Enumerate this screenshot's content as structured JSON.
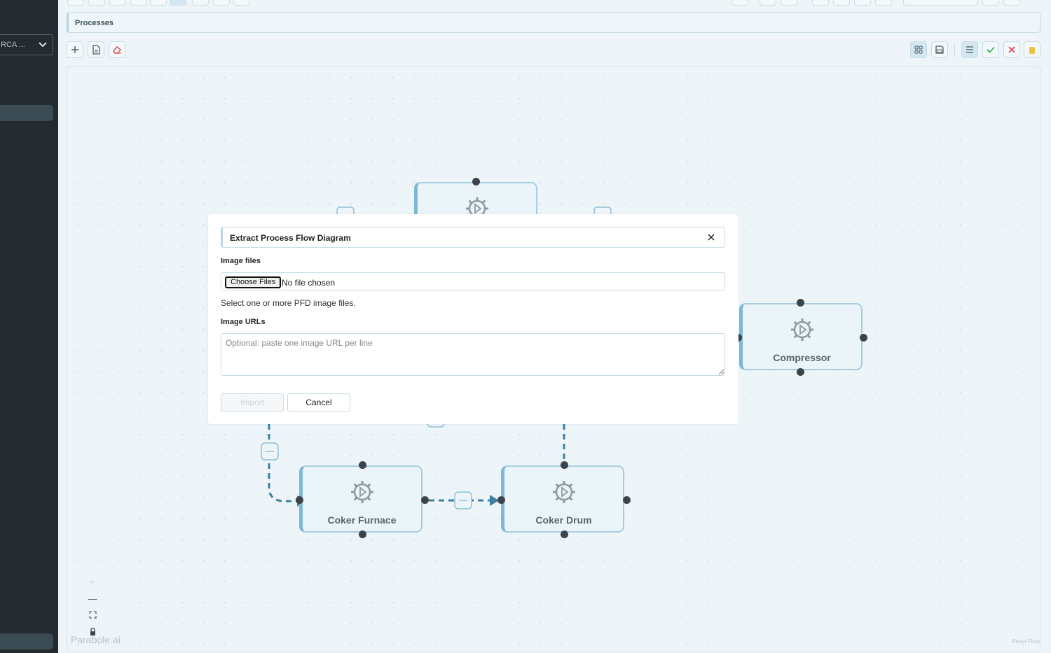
{
  "sidebar": {
    "dropdown_value": "RCA ..."
  },
  "header": {
    "title": "Processes"
  },
  "nodes": [
    {
      "label": ""
    },
    {
      "label": "Compressor"
    },
    {
      "label": "Coker Furnace"
    },
    {
      "label": "Coker Drum"
    }
  ],
  "canvas": {
    "watermark": "Parabole.ai",
    "attribution": "React Flow"
  },
  "dialog": {
    "title": "Extract Process Flow Diagram",
    "image_files_label": "Image files",
    "choose_button": "Choose Files",
    "file_status": "No file chosen",
    "hint": "Select one or more PFD image files.",
    "image_urls_label": "Image URLs",
    "urls_placeholder": "Optional: paste one image URL per line",
    "import_button": "Import",
    "cancel_button": "Cancel"
  },
  "colors": {
    "accent": "#7fb8d6",
    "edge": "#3b7fa3",
    "sidebar": "#252a2e"
  }
}
